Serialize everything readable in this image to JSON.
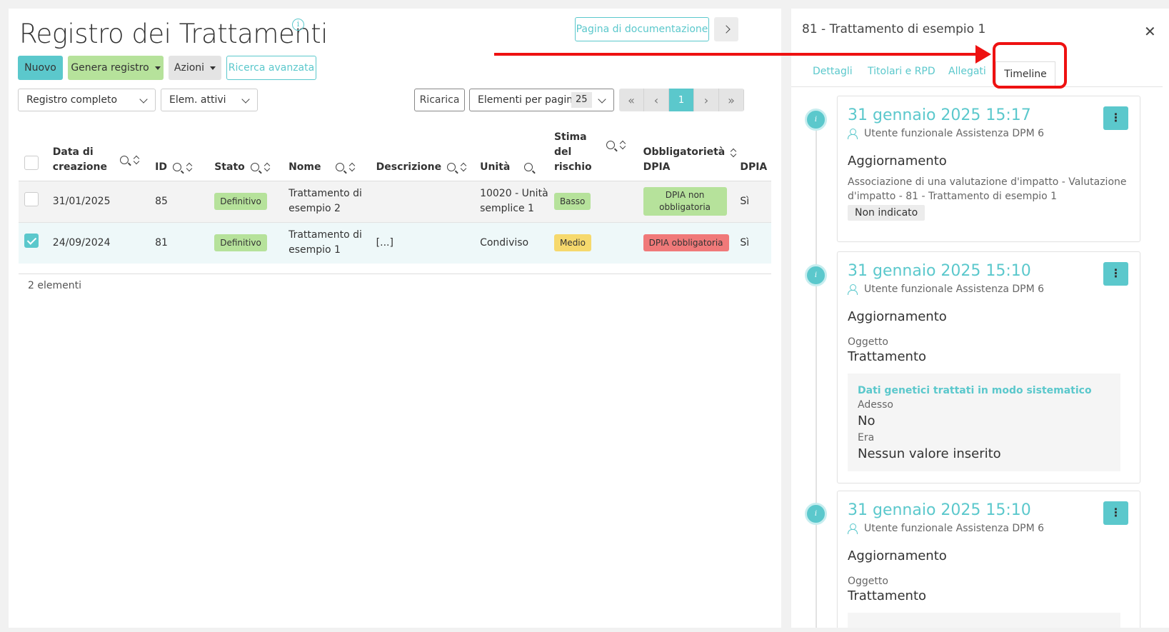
{
  "main": {
    "title": "Registro dei Trattamenti",
    "doc_button": "Pagina di documentazione",
    "toolbar": {
      "new": "Nuovo",
      "generate": "Genera registro",
      "actions": "Azioni",
      "advanced_search": "Ricerca avanzata"
    },
    "filters": {
      "registry": "Registro completo",
      "elements": "Elem. attivi"
    },
    "reload": "Ricarica",
    "per_page_label": "Elementi per pagina",
    "per_page_value": "25",
    "current_page": "1",
    "columns": {
      "created_1": "Data di",
      "created_2": "creazione",
      "id": "ID",
      "status": "Stato",
      "name": "Nome",
      "description": "Descrizione",
      "unit": "Unità",
      "risk_1": "Stima",
      "risk_2": "del",
      "risk_3": "rischio",
      "dpia_req_1": "Obbligatorietà",
      "dpia_req_2": "DPIA",
      "dpia": "DPIA"
    },
    "rows": [
      {
        "date": "31/01/2025",
        "id": "85",
        "status": "Definitivo",
        "name_1": "Trattamento di",
        "name_2": "esempio 2",
        "description": "",
        "unit_1": "10020 - Unità",
        "unit_2": "semplice 1",
        "risk": "Basso",
        "dpia_req_1": "DPIA non",
        "dpia_req_2": "obbligatoria",
        "dpia": "Sì",
        "checked": false
      },
      {
        "date": "24/09/2024",
        "id": "81",
        "status": "Definitivo",
        "name_1": "Trattamento di",
        "name_2": "esempio 1",
        "description": "[...]",
        "unit_1": "Condiviso",
        "unit_2": "",
        "risk": "Medio",
        "dpia_req_1": "DPIA obbligatoria",
        "dpia_req_2": "",
        "dpia": "Sì",
        "checked": true
      }
    ],
    "count": "2 elementi"
  },
  "detail": {
    "title": "81 - Trattamento di esempio 1",
    "tabs": [
      "Dettagli",
      "Titolari e RPD",
      "Allegati",
      "Timeline"
    ],
    "active_tab": "Timeline",
    "timeline": [
      {
        "date": "31 gennaio 2025 15:17",
        "user": "Utente funzionale Assistenza DPM 6",
        "kind": "Aggiornamento",
        "desc_1": "Associazione di una valutazione d'impatto - Valutazione",
        "desc_2": "d'impatto - 81 - Trattamento di esempio 1",
        "tag": "Non indicato"
      },
      {
        "date": "31 gennaio 2025 15:10",
        "user": "Utente funzionale Assistenza DPM 6",
        "kind": "Aggiornamento",
        "object_label": "Oggetto",
        "object_value": "Trattamento",
        "change_field": "Dati genetici trattati in modo sistematico",
        "now_label": "Adesso",
        "now_value": "No",
        "was_label": "Era",
        "was_value": "Nessun valore inserito"
      },
      {
        "date": "31 gennaio 2025 15:10",
        "user": "Utente funzionale Assistenza DPM 6",
        "kind": "Aggiornamento",
        "object_label": "Oggetto",
        "object_value": "Trattamento"
      }
    ]
  },
  "colors": {
    "accent": "#5bc8cc",
    "green": "#b6e29b",
    "yellow": "#f6d96d",
    "red": "#f07979",
    "annotation": "#ee1111"
  }
}
